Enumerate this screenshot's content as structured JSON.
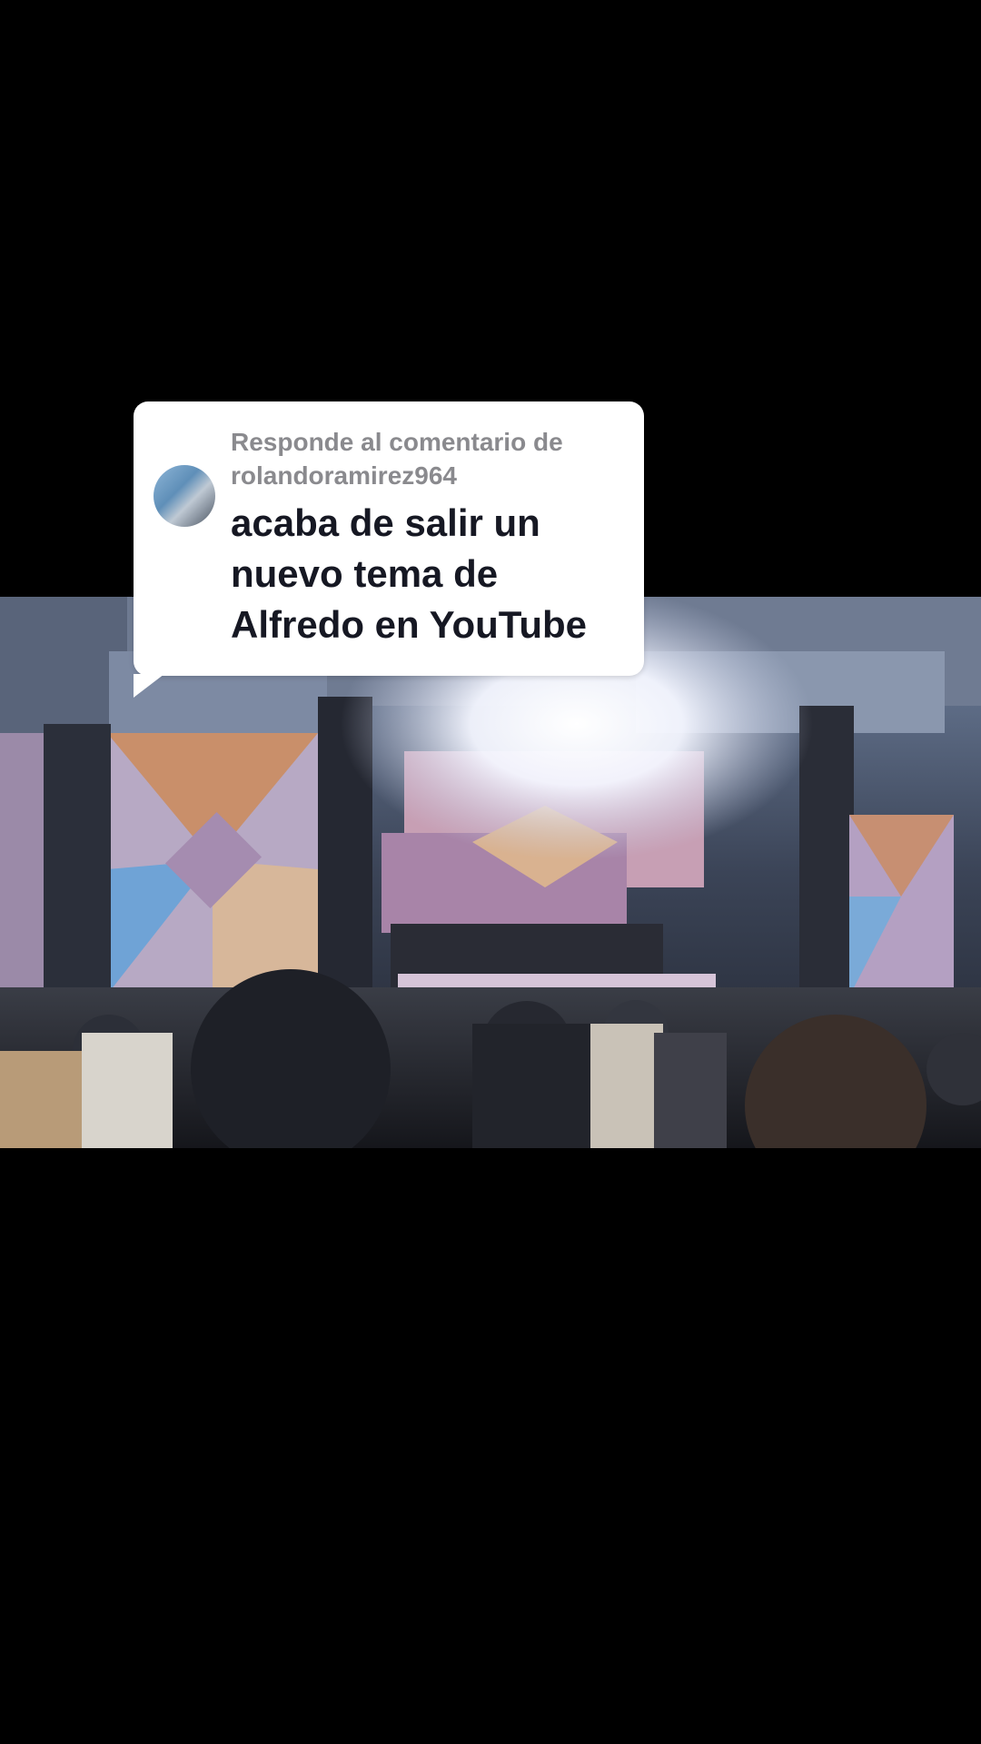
{
  "video": {
    "description_colors": {
      "background": "#000000",
      "card": "#ffffff",
      "header_text": "#8a8a8e",
      "body_text": "#161823"
    }
  },
  "reply_card": {
    "header_line1": "Responde al comentario de",
    "header_line2": "rolandoramirez964",
    "comment_lines": [
      "acaba de salir un",
      "nuevo tema de",
      "Alfredo en YouTube"
    ],
    "avatar_icon": "user-avatar-icon"
  }
}
